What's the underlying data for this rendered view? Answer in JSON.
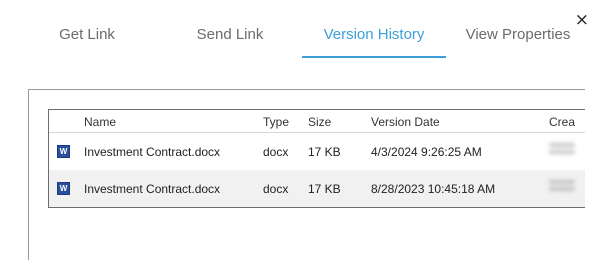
{
  "dialog": {
    "close_label": "×"
  },
  "tabs": [
    {
      "label": "Get Link"
    },
    {
      "label": "Send Link"
    },
    {
      "label": "Version History"
    },
    {
      "label": "View Properties"
    }
  ],
  "grid": {
    "columns": [
      "",
      "Name",
      "Type",
      "Size",
      "Version Date",
      "Crea"
    ],
    "rows": [
      {
        "icon": "word-doc-icon",
        "icon_letter": "W",
        "name": "Investment Contract.docx",
        "type": "docx",
        "size": "17 KB",
        "version_date": "4/3/2024 9:26:25 AM"
      },
      {
        "icon": "word-doc-icon",
        "icon_letter": "W",
        "name": "Investment Contract.docx",
        "type": "docx",
        "size": "17 KB",
        "version_date": "8/28/2023 10:45:18 AM"
      }
    ]
  },
  "colors": {
    "accent": "#3b9fd8",
    "tab_text": "#6b6b6b",
    "word_icon": "#2b4f9e"
  }
}
